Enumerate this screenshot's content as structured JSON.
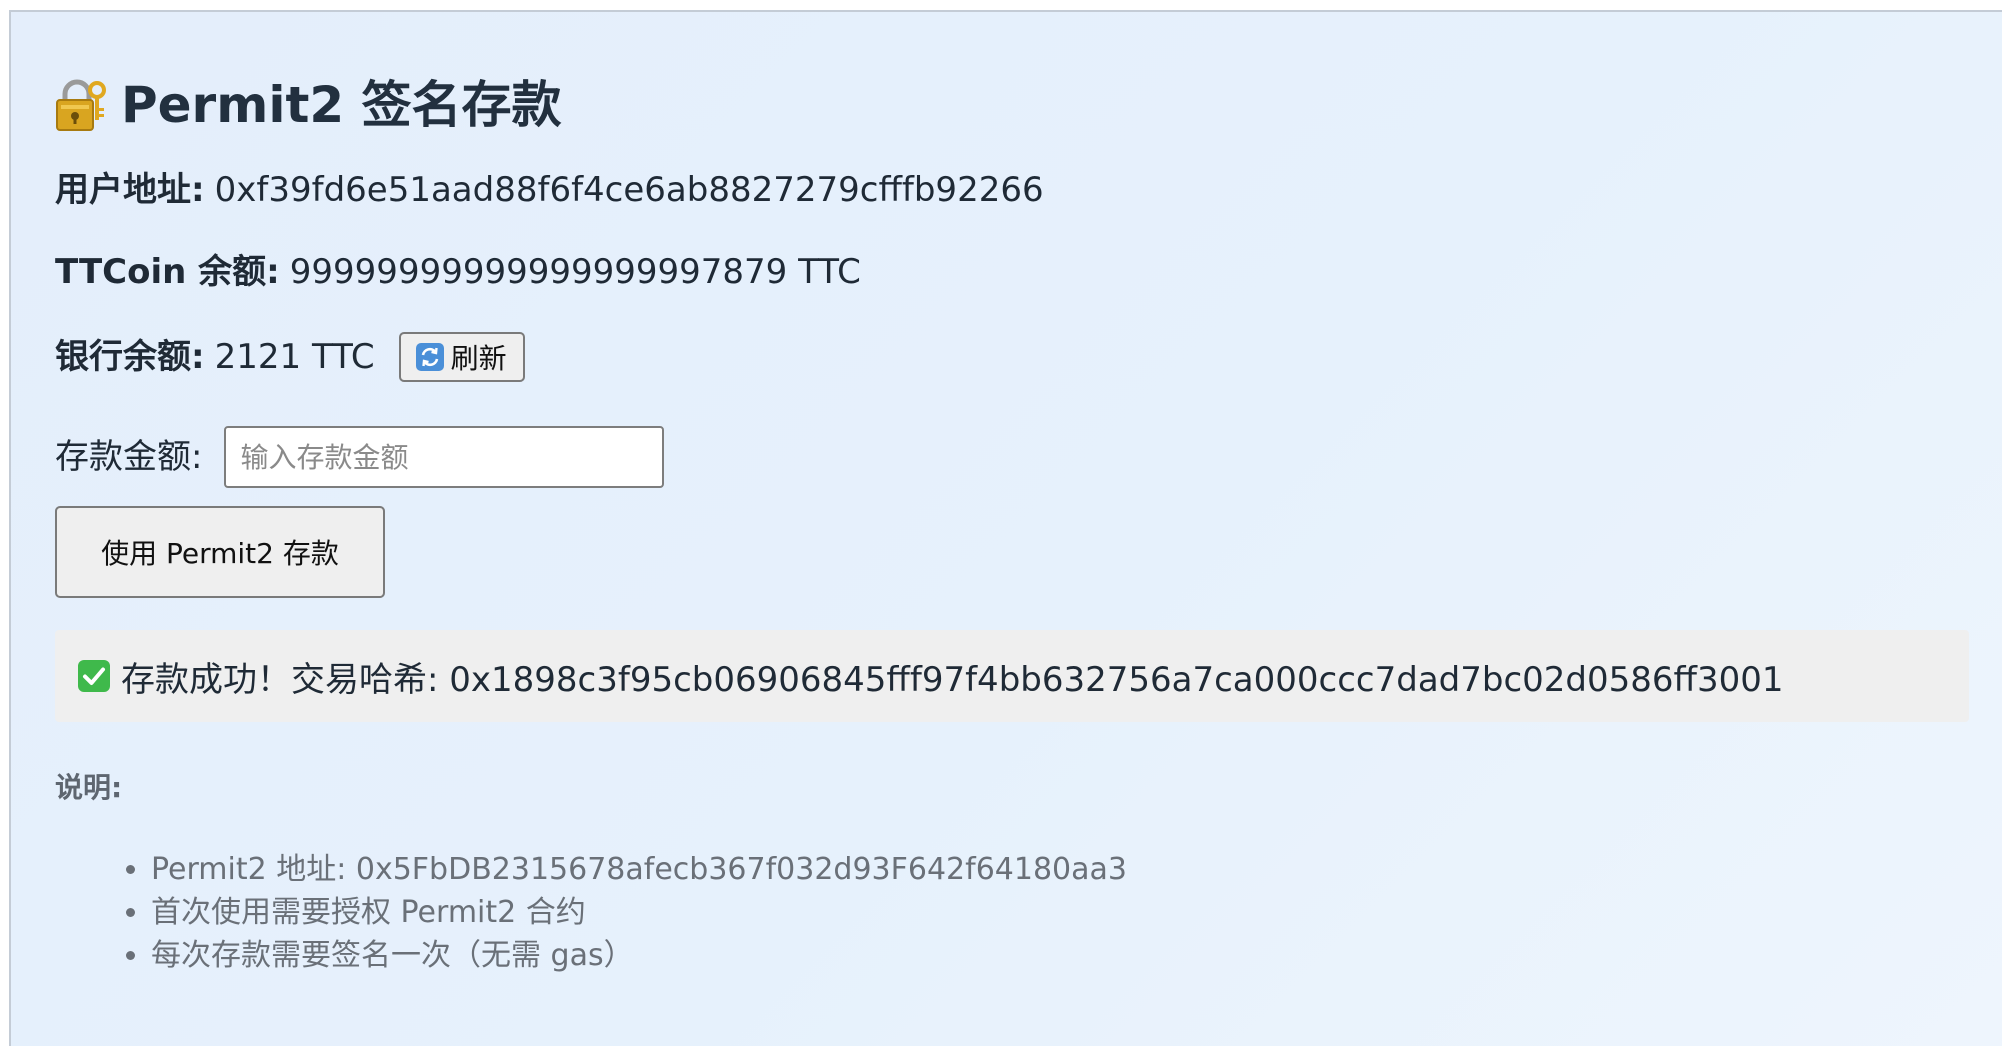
{
  "page": {
    "title": "Permit2 签名存款",
    "title_icon": "lock-with-key-icon"
  },
  "account": {
    "address_label": "用户地址:",
    "address_value": "0xf39fd6e51aad88f6f4ce6ab8827279cfffb92266",
    "ttc_balance_label": "TTCoin 余额:",
    "ttc_balance_value": "99999999999999999997879 TTC",
    "bank_balance_label": "银行余额:",
    "bank_balance_value": "2121 TTC",
    "refresh_label": "刷新",
    "refresh_icon": "refresh-icon"
  },
  "deposit": {
    "amount_label": "存款金额:",
    "amount_value": "",
    "amount_placeholder": "输入存款金额",
    "submit_label": "使用 Permit2 存款"
  },
  "status": {
    "icon": "check-mark-icon",
    "message": "存款成功！交易哈希: 0x1898c3f95cb06906845fff97f4bb632756a7ca000ccc7dad7bc02d0586ff3001"
  },
  "notes": {
    "title": "说明:",
    "items": [
      "Permit2 地址: 0x5FbDB2315678afecb367f032d93F642f64180aa3",
      "首次使用需要授权 Permit2 合约",
      "每次存款需要签名一次（无需 gas）"
    ]
  },
  "colors": {
    "panel_background": "#e4eefb",
    "title_text": "#22303f",
    "status_background": "#efefef",
    "notes_text": "#6a7078"
  }
}
